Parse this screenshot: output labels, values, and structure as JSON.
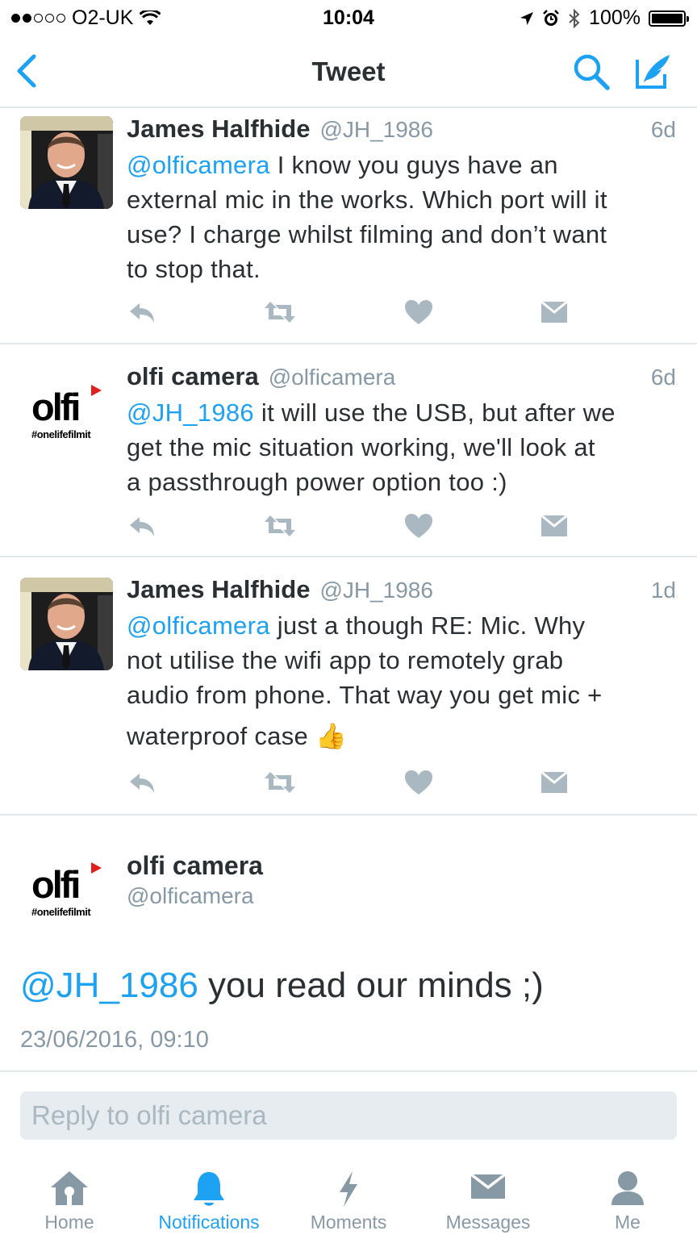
{
  "status_bar": {
    "carrier": "O2-UK",
    "time": "10:04",
    "battery": "100%",
    "battery_level": 1.0
  },
  "nav": {
    "title": "Tweet"
  },
  "tweets": [
    {
      "name": "James Halfhide",
      "handle": "@JH_1986",
      "time": "6d",
      "mention": "@olficamera",
      "lines": [
        " I know you guys have an",
        "external mic in the works. Which port will it",
        "use? I charge whilst filming and don’t want",
        "to stop that."
      ]
    },
    {
      "name": "olfi camera",
      "handle": "@olficamera",
      "time": "6d",
      "mention": "@JH_1986",
      "lines": [
        " it will use the USB, but after we",
        "get the mic situation working, we'll look at",
        "a passthrough power option too :)"
      ]
    },
    {
      "name": "James Halfhide",
      "handle": "@JH_1986",
      "time": "1d",
      "mention": "@olficamera",
      "lines": [
        " just a though RE: Mic. Why",
        "not utilise the wifi app to remotely grab",
        "audio from phone. That way you get mic +",
        "waterproof case"
      ],
      "emoji": "👍"
    }
  ],
  "focused_tweet": {
    "name": "olfi camera",
    "handle": "@olficamera",
    "mention": "@JH_1986",
    "text": " you read our minds ;)",
    "date": "23/06/2016, 09:10"
  },
  "olfi_logo": {
    "word": "olfi",
    "tag": "#onelifefilmit"
  },
  "reply": {
    "placeholder": "Reply to olfi camera"
  },
  "tabs": [
    {
      "label": "Home",
      "icon": "home-icon",
      "active": false
    },
    {
      "label": "Notifications",
      "icon": "bell-icon",
      "active": true
    },
    {
      "label": "Moments",
      "icon": "lightning-icon",
      "active": false
    },
    {
      "label": "Messages",
      "icon": "envelope-icon",
      "active": false
    },
    {
      "label": "Me",
      "icon": "person-icon",
      "active": false
    }
  ],
  "colors": {
    "accent": "#1da1f2",
    "muted": "#8899a6",
    "action_icon": "#aab8c2",
    "divider": "#e1e8ed"
  }
}
